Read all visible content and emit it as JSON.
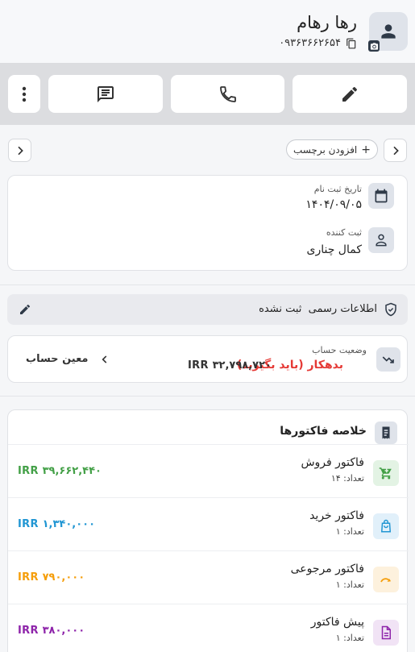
{
  "contact": {
    "name": "رها رهام",
    "phone": "۰۹۳۶۳۶۶۲۶۵۴"
  },
  "actions": {
    "icons": [
      "edit-icon",
      "phone-icon",
      "message-icon",
      "more-vert-icon"
    ]
  },
  "tags": {
    "add_label": "افزودن برچسب",
    "plus": "+"
  },
  "info": {
    "reg_date_label": "تاریخ ثبت نام",
    "reg_date_value": "۱۴۰۴/۰۹/۰۵",
    "registrar_label": "ثبت کننده",
    "registrar_value": "کمال چناری"
  },
  "official": {
    "label": "اطلاعات رسمی",
    "status": "ثبت نشده"
  },
  "account": {
    "label": "وضعیت حساب",
    "status": "بدهکار (باید بگیرید)",
    "amount": "IRR ۳۲,۷۹۸,۷۲۰",
    "moein_label": "معین حساب"
  },
  "invoices": {
    "title": "خلاصه فاکتورها",
    "items": [
      {
        "name": "فاکتور فروش",
        "count": "تعداد: ۱۴",
        "amount": "IRR ۳۹,۶۶۲,۴۴۰",
        "color": "#43a047",
        "bg": "#e3f3e4",
        "icon": "cart-icon"
      },
      {
        "name": "فاکتور خرید",
        "count": "تعداد: ۱",
        "amount": "IRR ۱,۳۴۰,۰۰۰",
        "color": "#2196d3",
        "bg": "#e1f0fa",
        "icon": "shopping-bag-icon"
      },
      {
        "name": "فاکتور مرجوعی",
        "count": "تعداد: ۱",
        "amount": "IRR ۷۹۰,۰۰۰",
        "color": "#f59e0b",
        "bg": "#fdf1dd",
        "icon": "return-icon"
      },
      {
        "name": "پیش فاکتور",
        "count": "تعداد: ۱",
        "amount": "IRR ۳۸۰,۰۰۰",
        "color": "#8e24aa",
        "bg": "#f1e3f5",
        "icon": "document-icon"
      }
    ]
  }
}
